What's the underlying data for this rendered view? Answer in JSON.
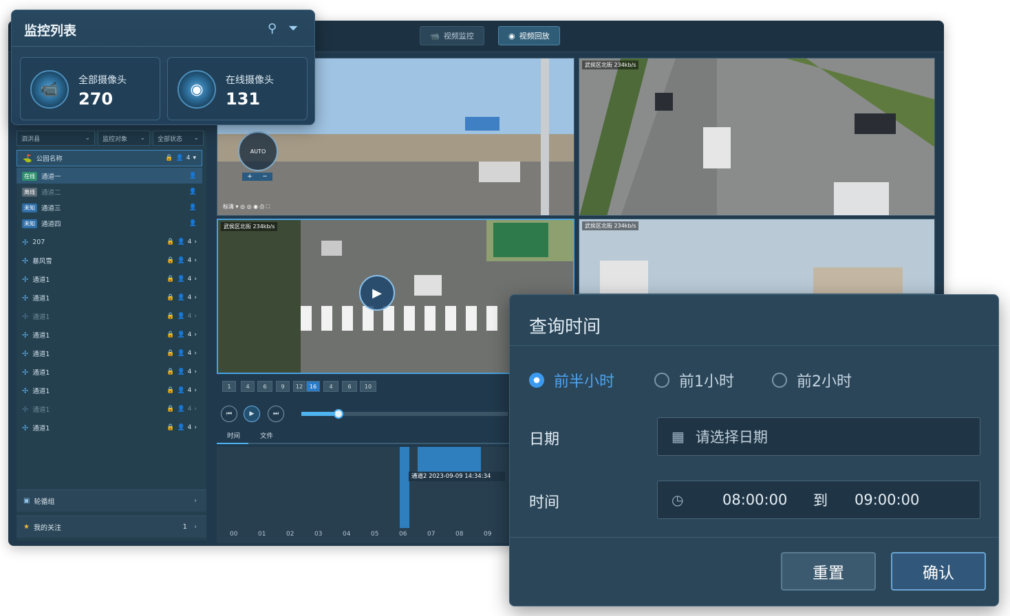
{
  "monitor_list": {
    "title": "监控列表",
    "stats": [
      {
        "label": "全部摄像头",
        "value": "270"
      },
      {
        "label": "在线摄像头",
        "value": "131"
      }
    ]
  },
  "top_tabs": [
    {
      "label": "视频监控",
      "active": false
    },
    {
      "label": "视频回放",
      "active": true
    }
  ],
  "filters": [
    "泗洪县",
    "监控对象",
    "全部状态"
  ],
  "tree": {
    "root": {
      "label": "公园名称",
      "count": "4"
    },
    "channels": [
      {
        "status": "在线",
        "label": "通道一",
        "dim": false
      },
      {
        "status": "离线",
        "label": "通道二",
        "dim": true
      },
      {
        "status": "未知",
        "label": "通道三",
        "dim": false
      },
      {
        "status": "未知",
        "label": "通道四",
        "dim": false
      }
    ],
    "groups": [
      {
        "label": "207",
        "count": "4",
        "dim": false
      },
      {
        "label": "暴风雪",
        "count": "4",
        "dim": false
      },
      {
        "label": "通道1",
        "count": "4",
        "dim": false
      },
      {
        "label": "通道1",
        "count": "4",
        "dim": false
      },
      {
        "label": "通道1",
        "count": "4",
        "dim": true
      },
      {
        "label": "通道1",
        "count": "4",
        "dim": false
      },
      {
        "label": "通道1",
        "count": "4",
        "dim": false
      },
      {
        "label": "通道1",
        "count": "4",
        "dim": false
      },
      {
        "label": "通道1",
        "count": "4",
        "dim": false
      },
      {
        "label": "通道1",
        "count": "4",
        "dim": true
      },
      {
        "label": "通道1",
        "count": "4",
        "dim": false
      }
    ]
  },
  "bottom_items": [
    {
      "label": "轮循组",
      "count": ""
    },
    {
      "label": "我的关注",
      "count": "1"
    }
  ],
  "videos": {
    "ptz": {
      "center": "AUTO",
      "quality": "标清"
    },
    "labels": [
      "武侯区北街 234kb/s",
      "武侯区北街 234kb/s",
      "武侯区北街 234kb/s"
    ]
  },
  "layout_options": [
    "1",
    "4",
    "6",
    "9",
    "12",
    "16",
    "4",
    "6",
    "10"
  ],
  "layout_selected": "16",
  "timeline": {
    "tabs": [
      "时间",
      "文件"
    ],
    "tooltip": "通道2 2023-09-09 14:34:34",
    "hours": [
      "00",
      "01",
      "02",
      "03",
      "04",
      "05",
      "06",
      "07",
      "08",
      "09"
    ],
    "progress": 0.3
  },
  "query_dialog": {
    "title": "查询时间",
    "options": [
      {
        "label": "前半小时",
        "checked": true
      },
      {
        "label": "前1小时",
        "checked": false
      },
      {
        "label": "前2小时",
        "checked": false
      }
    ],
    "date_label": "日期",
    "date_placeholder": "请选择日期",
    "time_label": "时间",
    "time_start": "08:00:00",
    "time_to": "到",
    "time_end": "09:00:00",
    "reset_label": "重置",
    "confirm_label": "确认"
  },
  "colors": {
    "accent": "#3a9af0",
    "panel": "#2b4659",
    "app_bg": "#21394c"
  },
  "icons": [
    "search-icon",
    "filter-icon",
    "camera-icon",
    "dome-camera-icon",
    "calendar-icon",
    "clock-icon",
    "play-icon",
    "star-icon",
    "lock-icon",
    "user-icon",
    "fan-icon"
  ]
}
